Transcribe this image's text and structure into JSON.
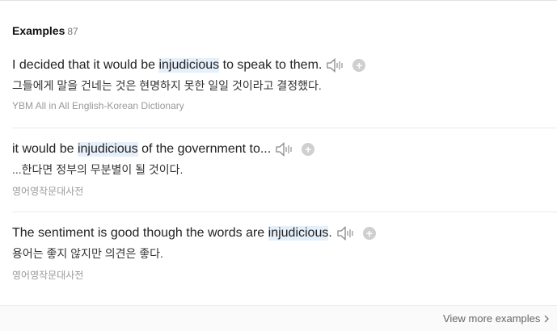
{
  "header": {
    "title": "Examples",
    "count": "87"
  },
  "examples": [
    {
      "before": "I decided that it would be ",
      "keyword": "injudicious",
      "after": " to speak to them.",
      "translation": "그들에게 말을 건네는 것은 현명하지 못한 일일 것이라고 결정했다.",
      "source": "YBM All in All English-Korean Dictionary"
    },
    {
      "before": "it would be ",
      "keyword": "injudicious",
      "after": " of the government to...",
      "translation": "...한다면 정부의 무분별이 될 것이다.",
      "source": "영어영작문대사전"
    },
    {
      "before": "The sentiment is good though the words are ",
      "keyword": "injudicious",
      "after": ".",
      "translation": "용어는 좋지 않지만 의견은 좋다.",
      "source": "영어영작문대사전"
    }
  ],
  "footer": {
    "more_label": "View more examples",
    "more_icon": "chevron-right"
  },
  "icons": {
    "audio": "speaker-icon",
    "add": "plus-icon"
  }
}
